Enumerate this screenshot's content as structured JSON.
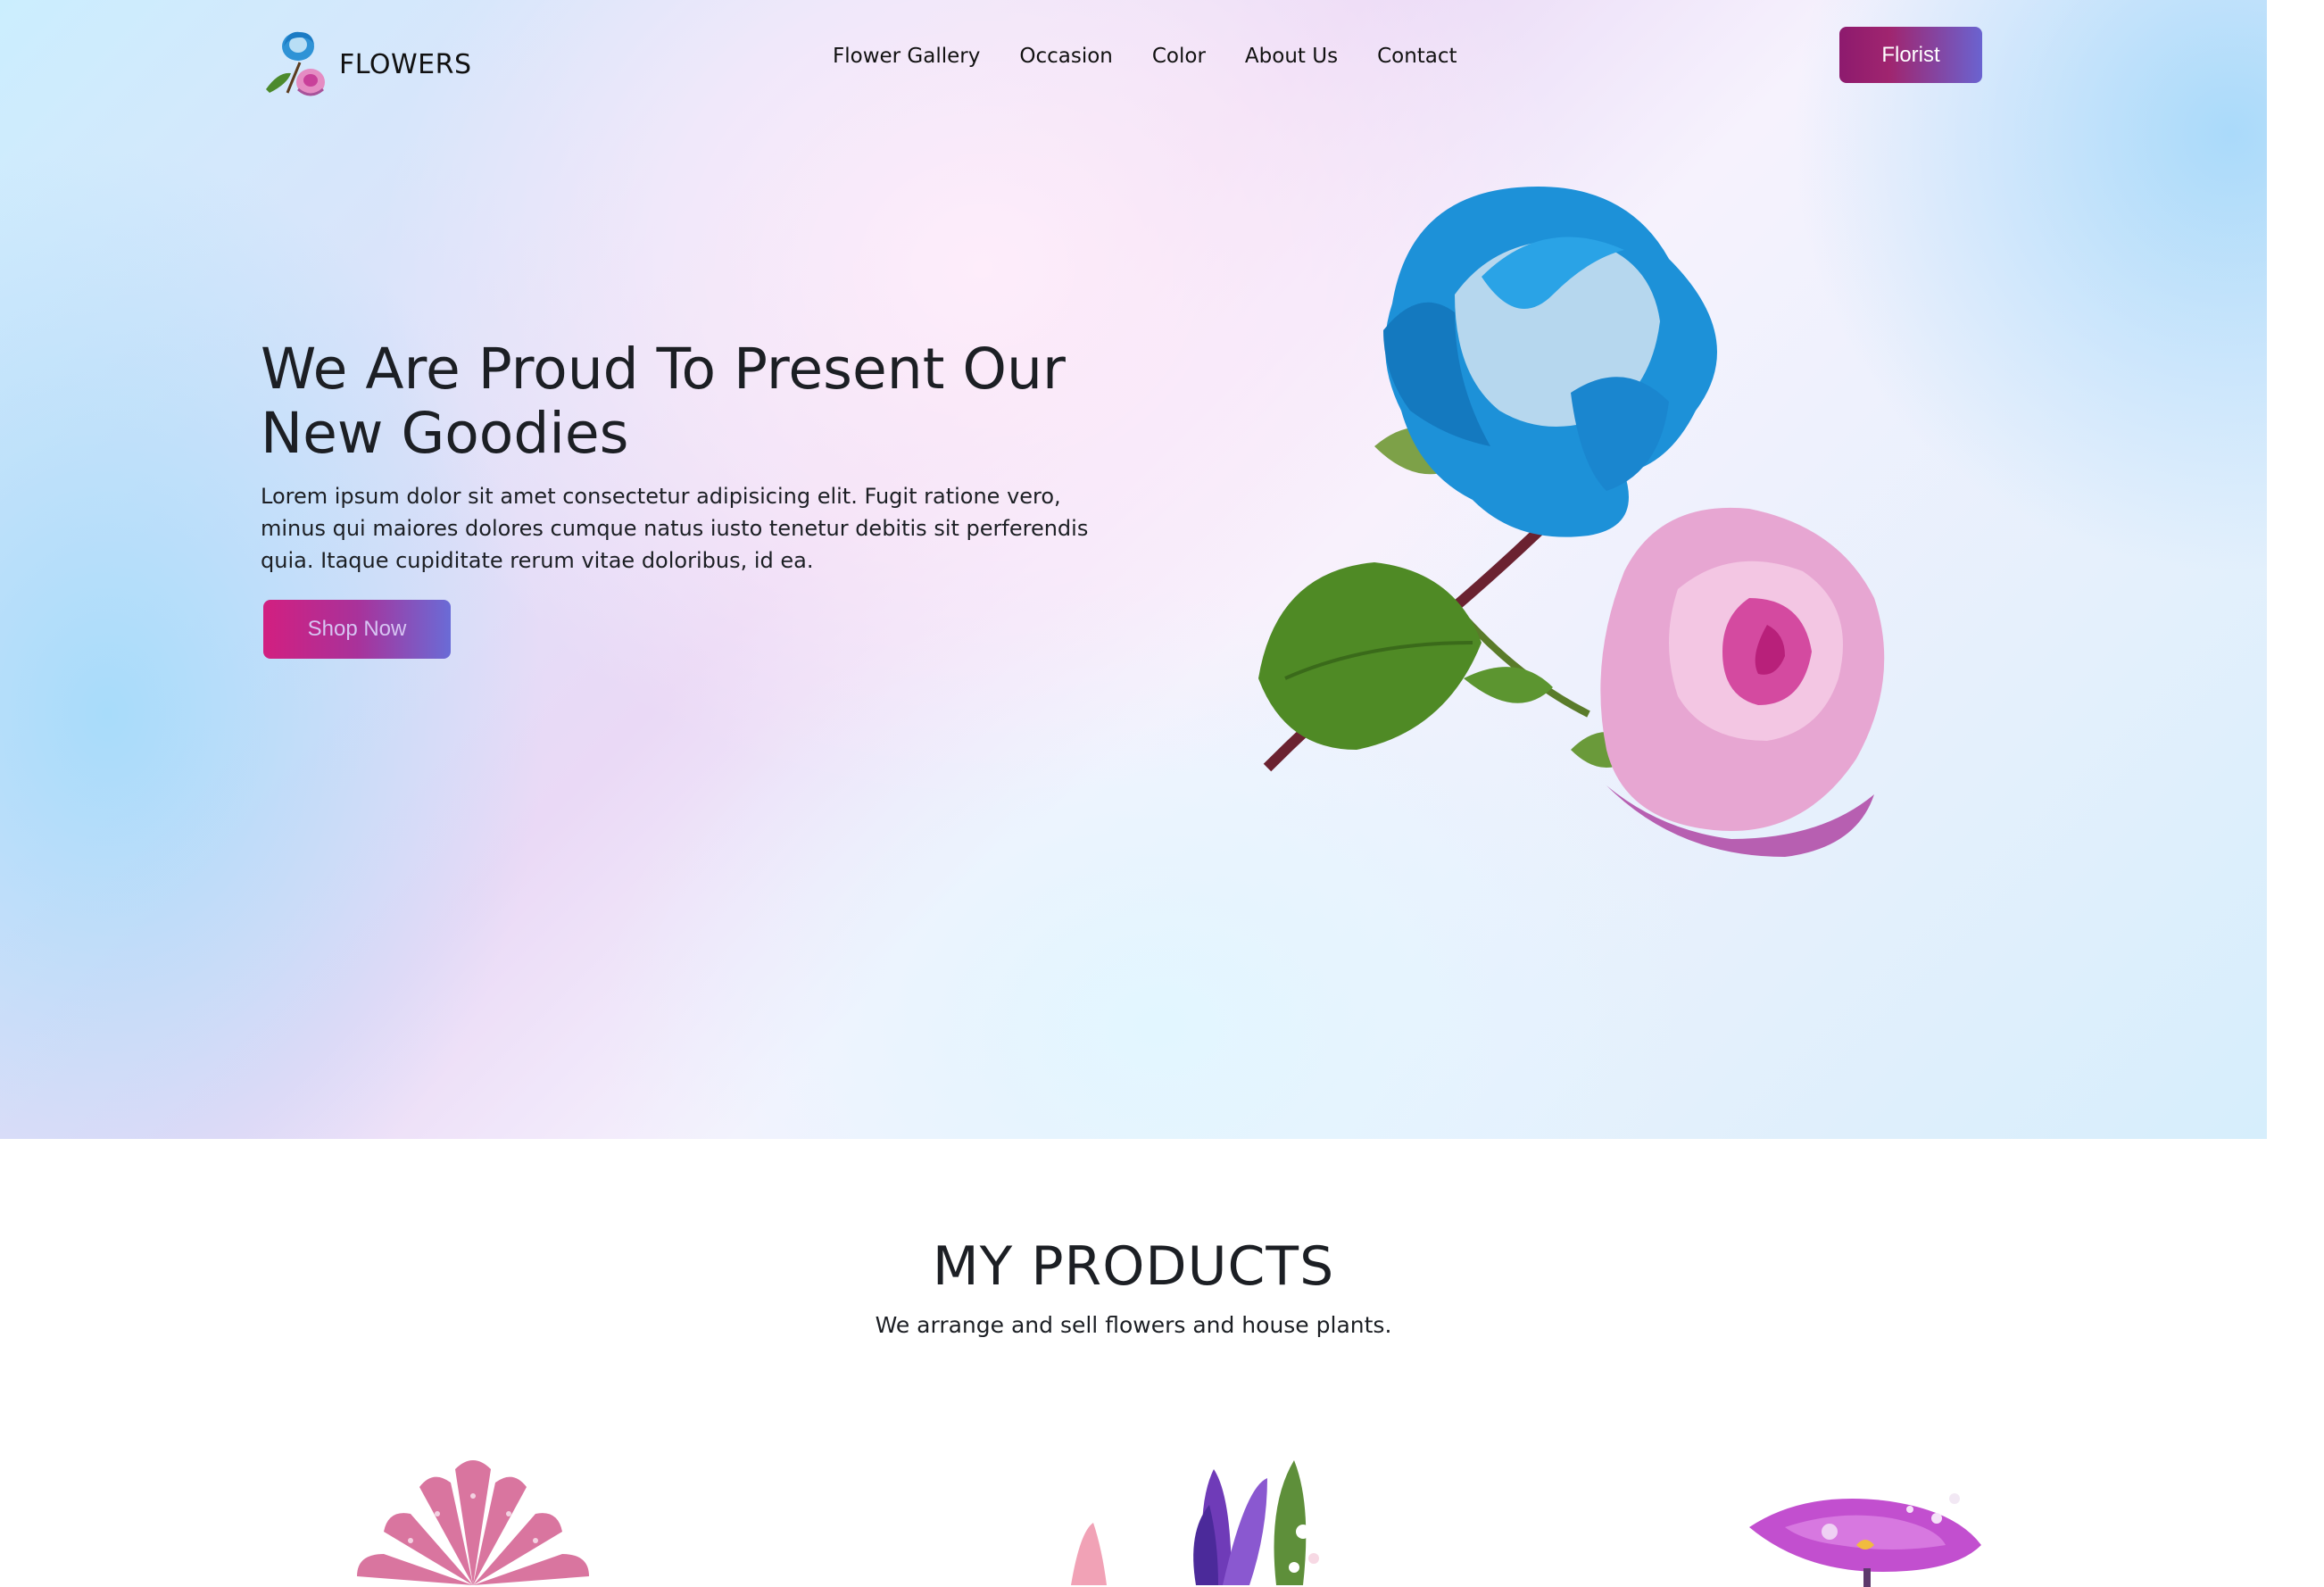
{
  "brand": {
    "name": "FLOWERS",
    "logo_icon": "rose-bouquet-icon"
  },
  "nav": {
    "links": [
      "Flower Gallery",
      "Occasion",
      "Color",
      "About Us",
      "Contact"
    ],
    "cta_label": "Florist"
  },
  "hero": {
    "title": "We Are Proud To Present Our New Goodies",
    "text": "Lorem ipsum dolor sit amet consectetur adipisicing elit. Fugit ratione vero, minus qui maiores dolores cumque natus iusto tenetur debitis sit perferendis quia. Itaque cupiditate rerum vitae doloribus, id ea.",
    "button_label": "Shop Now",
    "image": "blue-and-pink-roses"
  },
  "products": {
    "title": "MY PRODUCTS",
    "subtitle": "We arrange and sell flowers and house plants.",
    "items": [
      {
        "image": "pink-daisy-flower"
      },
      {
        "image": "purple-iris-bouquet"
      },
      {
        "image": "magenta-petal-flower"
      }
    ]
  },
  "colors": {
    "accent_start": "#8d1a6e",
    "accent_end": "#6a63d0",
    "shop_button_start": "#d21f80",
    "shop_button_end": "#6a6bd6",
    "text_dark": "#1c1f24"
  }
}
